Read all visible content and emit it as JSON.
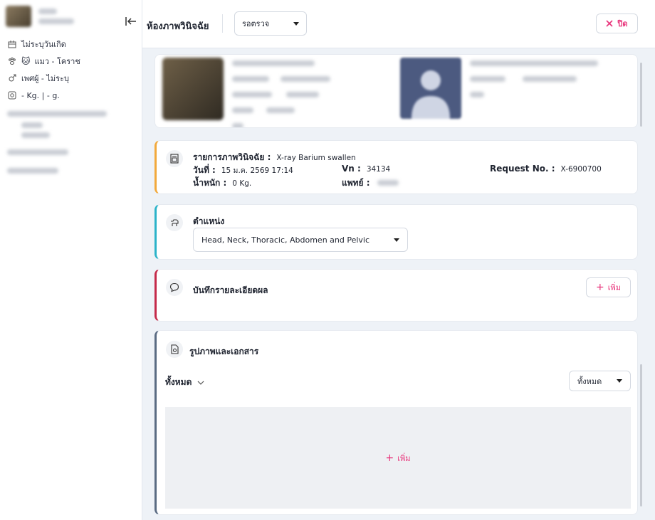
{
  "sidebar": {
    "items": [
      {
        "icon": "calendar-icon",
        "label": "ไม่ระบุวันเกิด"
      },
      {
        "icon": "paw-icon",
        "emoji": "🐱",
        "label": "แมว - โคราช"
      },
      {
        "icon": "gender-icon",
        "label": "เพศผู้ - ไม่ระบุ"
      },
      {
        "icon": "scale-icon",
        "label": "- Kg. | - g."
      }
    ]
  },
  "header": {
    "title": "ห้องภาพวินิจฉัย",
    "status_value": "รอตรวจ",
    "close_label": "ปิด"
  },
  "diagnosis": {
    "item_label": "รายการภาพวินิจฉัย :",
    "item_value": "X-ray Barium swallen",
    "date_label": "วันที่ :",
    "date_value": "15 ม.ค. 2569 17:14",
    "vn_label": "Vn :",
    "vn_value": "34134",
    "request_label": "Request No. :",
    "request_value": "X-6900700",
    "weight_label": "น้ำหนัก :",
    "weight_value": "0 Kg.",
    "doctor_label": "แพทย์ :"
  },
  "position": {
    "title": "ตำแหน่ง",
    "value": "Head, Neck, Thoracic, Abdomen and Pelvic"
  },
  "result": {
    "title": "บันทึกรายละเอียดผล",
    "add_label": "เพิ่ม"
  },
  "documents": {
    "title": "รูปภาพและเอกสาร",
    "filter_label": "ทั้งหมด",
    "filter_select_value": "ทั้งหมด",
    "add_label": "เพิ่ม"
  },
  "colors": {
    "accent_pink": "#e8337a",
    "diagnosis_border": "#f2a93b",
    "position_border": "#2bb3c9",
    "result_border": "#c52a4a",
    "documents_border": "#5a6b82"
  }
}
